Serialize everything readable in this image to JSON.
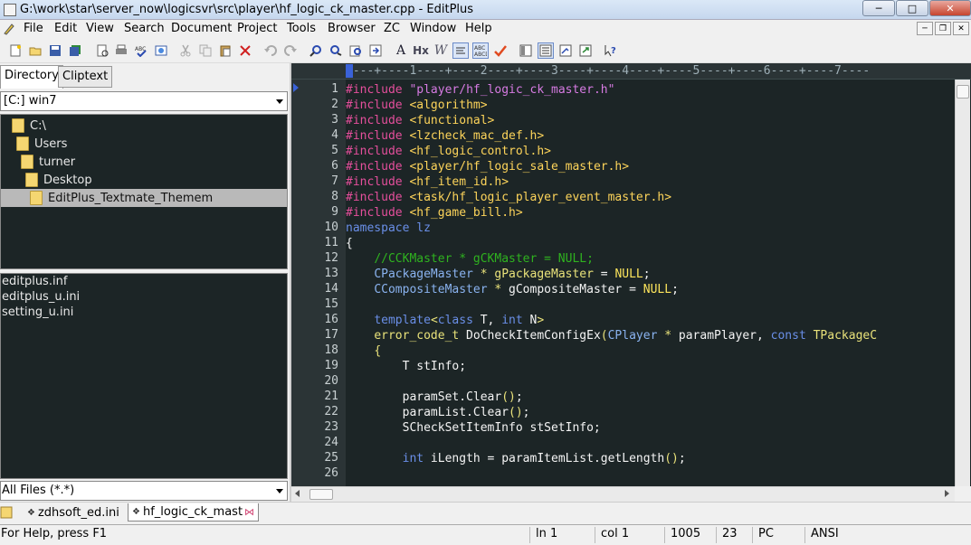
{
  "window": {
    "title": "G:\\work\\star\\server_now\\logicsvr\\src\\player\\hf_logic_ck_master.cpp - EditPlus"
  },
  "menu": [
    "File",
    "Edit",
    "View",
    "Search",
    "Document",
    "Project",
    "Tools",
    "Browser",
    "ZC",
    "Window",
    "Help"
  ],
  "toolbar": {
    "items": [
      "new-icon",
      "open-icon",
      "save-icon",
      "save-all-icon",
      "print-preview-icon",
      "print-icon",
      "spell-check-icon",
      "browser-icon",
      "cut-icon",
      "copy-icon",
      "paste-icon",
      "delete-icon",
      "undo-icon",
      "redo-icon",
      "find-icon",
      "replace-icon",
      "find-in-files-icon",
      "goto-icon",
      "font-icon",
      "hex-icon",
      "word-wrap-icon",
      "wrap-toggle-icon",
      "abc-icon",
      "check-icon",
      "directory-window-icon",
      "output-window-icon",
      "document-selector-icon",
      "fullscreen-icon",
      "help-icon"
    ],
    "font_label": "A",
    "hex_label": "Hx",
    "wrap_label": "W"
  },
  "left_panel": {
    "tabs": [
      "Directory",
      "Cliptext"
    ],
    "active_tab": "Directory",
    "drive": "[C:] win7",
    "tree": [
      {
        "label": "C:\\",
        "indent": 0
      },
      {
        "label": "Users",
        "indent": 1
      },
      {
        "label": "turner",
        "indent": 2
      },
      {
        "label": "Desktop",
        "indent": 3
      },
      {
        "label": "EditPlus_Textmate_Themem",
        "indent": 4,
        "selected": true
      }
    ],
    "files": [
      "editplus.inf",
      "editplus_u.ini",
      "setting_u.ini"
    ],
    "filter": "All Files (*.*)"
  },
  "editor": {
    "ruler": "----+----1----+----2----+----3----+----4----+----5----+----6----+----7----",
    "lines": [
      {
        "n": "1",
        "tokens": [
          [
            "pp",
            "#include "
          ],
          [
            "str",
            "\"player/hf_logic_ck_master.h\""
          ]
        ]
      },
      {
        "n": "2",
        "tokens": [
          [
            "pp",
            "#include "
          ],
          [
            "inc",
            "<algorithm>"
          ]
        ]
      },
      {
        "n": "3",
        "tokens": [
          [
            "pp",
            "#include "
          ],
          [
            "inc",
            "<functional>"
          ]
        ]
      },
      {
        "n": "4",
        "tokens": [
          [
            "pp",
            "#include "
          ],
          [
            "inc",
            "<lzcheck_mac_def.h>"
          ]
        ]
      },
      {
        "n": "5",
        "tokens": [
          [
            "pp",
            "#include "
          ],
          [
            "inc",
            "<hf_logic_control.h>"
          ]
        ]
      },
      {
        "n": "6",
        "tokens": [
          [
            "pp",
            "#include "
          ],
          [
            "inc",
            "<player/hf_logic_sale_master.h>"
          ]
        ]
      },
      {
        "n": "7",
        "tokens": [
          [
            "pp",
            "#include "
          ],
          [
            "inc",
            "<hf_item_id.h>"
          ]
        ]
      },
      {
        "n": "8",
        "tokens": [
          [
            "pp",
            "#include "
          ],
          [
            "inc",
            "<task/hf_logic_player_event_master.h>"
          ]
        ]
      },
      {
        "n": "9",
        "tokens": [
          [
            "pp",
            "#include "
          ],
          [
            "inc",
            "<hf_game_bill.h>"
          ]
        ]
      },
      {
        "n": "10",
        "tokens": [
          [
            "kw",
            "namespace lz"
          ]
        ]
      },
      {
        "n": "11",
        "tokens": [
          [
            "num",
            "{"
          ]
        ]
      },
      {
        "n": "12",
        "tokens": [
          [
            "num",
            "    "
          ],
          [
            "cmt",
            "//CCKMaster * gCKMaster = NULL;"
          ]
        ]
      },
      {
        "n": "13",
        "tokens": [
          [
            "num",
            "    "
          ],
          [
            "typ",
            "CPackageMaster"
          ],
          [
            "num",
            " "
          ],
          [
            "cls",
            "*"
          ],
          [
            "num",
            " "
          ],
          [
            "cls",
            "gPackageMaster"
          ],
          [
            "num",
            " = "
          ],
          [
            "null",
            "NULL"
          ],
          [
            "num",
            ";"
          ]
        ]
      },
      {
        "n": "14",
        "tokens": [
          [
            "num",
            "    "
          ],
          [
            "typ",
            "CCompositeMaster"
          ],
          [
            "num",
            " "
          ],
          [
            "cls",
            "*"
          ],
          [
            "num",
            " gCompositeMaster = "
          ],
          [
            "null",
            "NULL"
          ],
          [
            "num",
            ";"
          ]
        ]
      },
      {
        "n": "15",
        "tokens": []
      },
      {
        "n": "16",
        "tokens": [
          [
            "num",
            "    "
          ],
          [
            "kw",
            "template"
          ],
          [
            "cls",
            "<"
          ],
          [
            "kw",
            "class"
          ],
          [
            "num",
            " T, "
          ],
          [
            "kw",
            "int"
          ],
          [
            "num",
            " N"
          ],
          [
            "cls",
            ">"
          ]
        ]
      },
      {
        "n": "17",
        "tokens": [
          [
            "num",
            "    "
          ],
          [
            "cls",
            "error_code_t"
          ],
          [
            "num",
            " DoCheckItemConfigEx"
          ],
          [
            "cls",
            "("
          ],
          [
            "typ",
            "CPlayer"
          ],
          [
            "num",
            " "
          ],
          [
            "cls",
            "*"
          ],
          [
            "num",
            " paramPlayer, "
          ],
          [
            "kw",
            "const"
          ],
          [
            "num",
            " "
          ],
          [
            "cls",
            "TPackageC"
          ]
        ]
      },
      {
        "n": "18",
        "tokens": [
          [
            "num",
            "    "
          ],
          [
            "cls",
            "{"
          ]
        ]
      },
      {
        "n": "19",
        "tokens": [
          [
            "num",
            "        T stInfo;"
          ]
        ]
      },
      {
        "n": "20",
        "tokens": []
      },
      {
        "n": "21",
        "tokens": [
          [
            "num",
            "        paramSet.Clear"
          ],
          [
            "cls",
            "()"
          ],
          [
            "num",
            ";"
          ]
        ]
      },
      {
        "n": "22",
        "tokens": [
          [
            "num",
            "        paramList.Clear"
          ],
          [
            "cls",
            "()"
          ],
          [
            "num",
            ";"
          ]
        ]
      },
      {
        "n": "23",
        "tokens": [
          [
            "num",
            "        SCheckSetItemInfo stSetInfo;"
          ]
        ]
      },
      {
        "n": "24",
        "tokens": []
      },
      {
        "n": "25",
        "tokens": [
          [
            "num",
            "        "
          ],
          [
            "kw",
            "int"
          ],
          [
            "num",
            " iLength = paramItemList.getLength"
          ],
          [
            "cls",
            "()"
          ],
          [
            "num",
            ";"
          ]
        ]
      },
      {
        "n": "26",
        "tokens": []
      }
    ]
  },
  "doc_tabs": [
    {
      "label": "zdhsoft_ed.ini",
      "active": false
    },
    {
      "label": "hf_logic_ck_mast",
      "active": true
    }
  ],
  "status": {
    "help": "For Help, press F1",
    "line": "ln 1",
    "col": "col 1",
    "total": "1005",
    "num": "23",
    "mode": "PC",
    "encoding": "ANSI"
  }
}
